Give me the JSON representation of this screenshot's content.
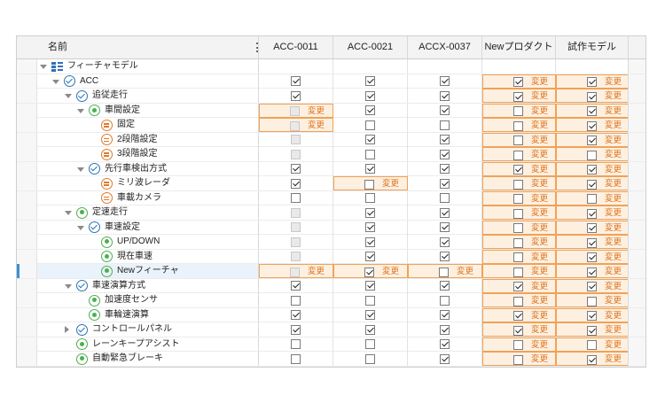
{
  "header": {
    "name": "名前",
    "columns": [
      "ACC-0011",
      "ACC-0021",
      "ACCX-0037",
      "Newプロダクト",
      "試作モデル"
    ]
  },
  "change_label": "変更",
  "colors": {
    "accent": "#f0a257",
    "highlight_bg": "#fdf0e1",
    "change_text": "#e0761f",
    "selection": "#3b8fd9"
  },
  "rows": [
    {
      "label": "フィーチャモデル",
      "icon": "model-icon",
      "toggle": "open",
      "level": 0,
      "cells": [
        "",
        "",
        "",
        "",
        ""
      ]
    },
    {
      "label": "ACC",
      "icon": "check-icon",
      "toggle": "open",
      "level": 1,
      "cells": [
        "on",
        "on",
        "on",
        "on*",
        "on*"
      ]
    },
    {
      "label": "追従走行",
      "icon": "check-icon",
      "toggle": "open",
      "level": 2,
      "cells": [
        "on",
        "on",
        "on",
        "on*",
        "on*"
      ]
    },
    {
      "label": "車間設定",
      "icon": "dot-icon",
      "toggle": "open",
      "level": 3,
      "cells": [
        "dis*",
        "on",
        "on",
        "off*",
        "on*"
      ]
    },
    {
      "label": "固定",
      "icon": "alt-icon",
      "toggle": "",
      "level": 4,
      "cells": [
        "dis*",
        "off",
        "off",
        "off*",
        "on*"
      ]
    },
    {
      "label": "2段階設定",
      "icon": "alt-icon",
      "toggle": "",
      "level": 4,
      "cells": [
        "dis",
        "on",
        "on",
        "off*",
        "on*"
      ]
    },
    {
      "label": "3段階設定",
      "icon": "alt-icon",
      "toggle": "",
      "level": 4,
      "cells": [
        "dis",
        "off",
        "on",
        "off*",
        "off*"
      ]
    },
    {
      "label": "先行車検出方式",
      "icon": "check-icon",
      "toggle": "open",
      "level": 3,
      "cells": [
        "on",
        "on",
        "on",
        "on*",
        "on*"
      ]
    },
    {
      "label": "ミリ波レーダ",
      "icon": "alt-icon",
      "toggle": "",
      "level": 4,
      "cells": [
        "on",
        "off*",
        "on",
        "off*",
        "on*"
      ]
    },
    {
      "label": "車載カメラ",
      "icon": "alt-icon",
      "toggle": "",
      "level": 4,
      "cells": [
        "off",
        "off",
        "off",
        "off*",
        "off*"
      ]
    },
    {
      "label": "定速走行",
      "icon": "dot-icon",
      "toggle": "open",
      "level": 2,
      "cells": [
        "dis",
        "on",
        "on",
        "off*",
        "on*"
      ]
    },
    {
      "label": "車速設定",
      "icon": "check-icon",
      "toggle": "open",
      "level": 3,
      "cells": [
        "dis",
        "on",
        "on",
        "off*",
        "on*"
      ]
    },
    {
      "label": "UP/DOWN",
      "icon": "dot-icon",
      "toggle": "",
      "level": 4,
      "cells": [
        "dis",
        "on",
        "on",
        "off*",
        "on*"
      ]
    },
    {
      "label": "現在車速",
      "icon": "dot-icon",
      "toggle": "",
      "level": 4,
      "cells": [
        "dis",
        "on",
        "on",
        "off*",
        "on*"
      ]
    },
    {
      "label": "Newフィーチャ",
      "icon": "dot-icon",
      "toggle": "",
      "level": 4,
      "selected": true,
      "cells": [
        "dis*",
        "on*",
        "off*",
        "off*",
        "on*"
      ]
    },
    {
      "label": "車速演算方式",
      "icon": "check-icon",
      "toggle": "open",
      "level": 2,
      "cells": [
        "on",
        "on",
        "on",
        "on*",
        "on*"
      ]
    },
    {
      "label": "加速度センサ",
      "icon": "dot-icon",
      "toggle": "",
      "level": 3,
      "cells": [
        "off",
        "off",
        "off",
        "off*",
        "off*"
      ]
    },
    {
      "label": "車輪速演算",
      "icon": "dot-icon",
      "toggle": "",
      "level": 3,
      "cells": [
        "on",
        "on",
        "on",
        "on*",
        "on*"
      ]
    },
    {
      "label": "コントロールパネル",
      "icon": "check-icon",
      "toggle": "closed",
      "level": 2,
      "cells": [
        "on",
        "on",
        "on",
        "on*",
        "on*"
      ]
    },
    {
      "label": "レーンキープアシスト",
      "icon": "dot-icon",
      "toggle": "",
      "level": 2,
      "cells": [
        "off",
        "off",
        "on",
        "off*",
        "off*"
      ]
    },
    {
      "label": "自動緊急ブレーキ",
      "icon": "dot-icon",
      "toggle": "",
      "level": 2,
      "cells": [
        "off",
        "off",
        "on",
        "off*",
        "on*"
      ]
    }
  ]
}
